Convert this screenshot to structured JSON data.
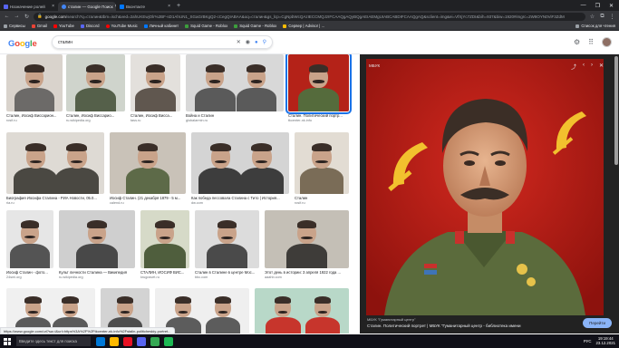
{
  "browser": {
    "tabs": [
      {
        "label": "Назначение ролей",
        "active": false,
        "favicon_color": "#5865f2"
      },
      {
        "label": "сталин — Google Поиск",
        "active": true,
        "favicon_color": "#4285f4"
      },
      {
        "label": "Вконтакте",
        "active": false,
        "favicon_color": "#0077ff"
      }
    ],
    "new_tab": "+",
    "window_controls": [
      "—",
      "❐",
      "✕"
    ],
    "nav": {
      "back": "←",
      "forward": "→",
      "reload": "↻"
    },
    "url_host": "google.com",
    "url_rest": "/search?q=сталин&tbm=isch&ved=2ahUKEwjOlr%2BF-sD1AhUN1_SGaGrBKgQ2-cCegQIABAA&oq=сталин&gs_lcp=CgNpbWcQAzIECCMQJzIFCAAQgAQyBQgAEIAEMgUIABCABDIFCAAQgAQ&sclient=img&ei=VfXjYc7ZDI&bih=937&biw=1920#imgrc=2W8OYN0ViF3ZdM",
    "bookmarks": [
      {
        "label": "Сервисы",
        "color": "#e8eaed"
      },
      {
        "label": "Gmail",
        "color": "#ea4335"
      },
      {
        "label": "YouTube",
        "color": "#ff0000"
      },
      {
        "label": "Discord",
        "color": "#5865f2"
      },
      {
        "label": "YouTube Music",
        "color": "#ff0000"
      },
      {
        "label": "Личный кабинет",
        "color": "#0077ff"
      },
      {
        "label": "Squid Game - Roblox",
        "color": "#3c9d3c"
      },
      {
        "label": "Squid Game - Roblox",
        "color": "#3c9d3c"
      },
      {
        "label": "Сервер | Advisor | ...",
        "color": "#fbbc05"
      }
    ],
    "reading_list": "Список для чтения"
  },
  "google": {
    "logo": "Google",
    "query": "сталин",
    "icons": {
      "clear": "✕",
      "camera": "📷",
      "mic": "🎤",
      "search": "🔍"
    }
  },
  "results": [
    {
      "caption": "Сталин, Иосиф Виссарион...",
      "source": "rosif.ru"
    },
    {
      "caption": "Сталин, Иосиф Виссарио...",
      "source": "ru.wikipedia.org"
    },
    {
      "caption": "Сталин, Иосиф Висса...",
      "source": "tass.ru"
    },
    {
      "caption": "Война и Сталин",
      "source": "globalarmin.ru"
    },
    {
      "caption": "Сталин. Политический портр...",
      "source": "tkcenter-nk.info"
    },
    {
      "caption": "Биография Иосифа Сталина - РИА Новости, 05.0...",
      "source": "ria.ru"
    },
    {
      "caption": "Иосиф Сталин. (21 декабря 1879 - 5 м...",
      "source": "calend.ru"
    },
    {
      "caption": "Как победа пессовала Сталина с Тито | История...",
      "source": "dw.com"
    },
    {
      "caption": "Сталин",
      "source": "rosif.ru"
    },
    {
      "caption": "Иосиф Сталин - фото...",
      "source": "24smi.org"
    },
    {
      "caption": "Культ личности Сталина — Википедия",
      "source": "ru.wikipedia.org"
    },
    {
      "caption": "СТАЛИН, ИОСИФ ВИС...",
      "source": "krugosvet.ru"
    },
    {
      "caption": "Сталин в Сталине в центре Мос...",
      "source": "bbc.com"
    },
    {
      "caption": "Этот день в истории: 3 апреля 1922 года ...",
      "source": "aaahb.com"
    },
    {
      "caption": "",
      "source": ""
    },
    {
      "caption": "",
      "source": ""
    },
    {
      "caption": "",
      "source": ""
    },
    {
      "caption": "",
      "source": ""
    }
  ],
  "panel": {
    "site": "МБУК \"Гуманитарный центр\"",
    "title": "Сталин. Политический портрет | МБУК \"Гуманитарный центр - библиотека имени",
    "goto": "Перейти",
    "watermark": "МБУК",
    "controls": {
      "share": "⤴",
      "prev": "‹",
      "next": "›",
      "close": "✕"
    }
  },
  "status_url": "https://www.google.com/url?sa=i&url=https%3A%2F%2Ftkcenter-nk.info%2Fstalin-politicheskiy-portret...",
  "taskbar": {
    "search_placeholder": "Введите здесь текст для поиска",
    "apps": [
      "#0078d7",
      "#ffb900",
      "#e81123",
      "#5865f2",
      "#34a853",
      "#1db954"
    ],
    "language": "РУС",
    "time": "19:19:44",
    "date": "23.12.2021"
  }
}
